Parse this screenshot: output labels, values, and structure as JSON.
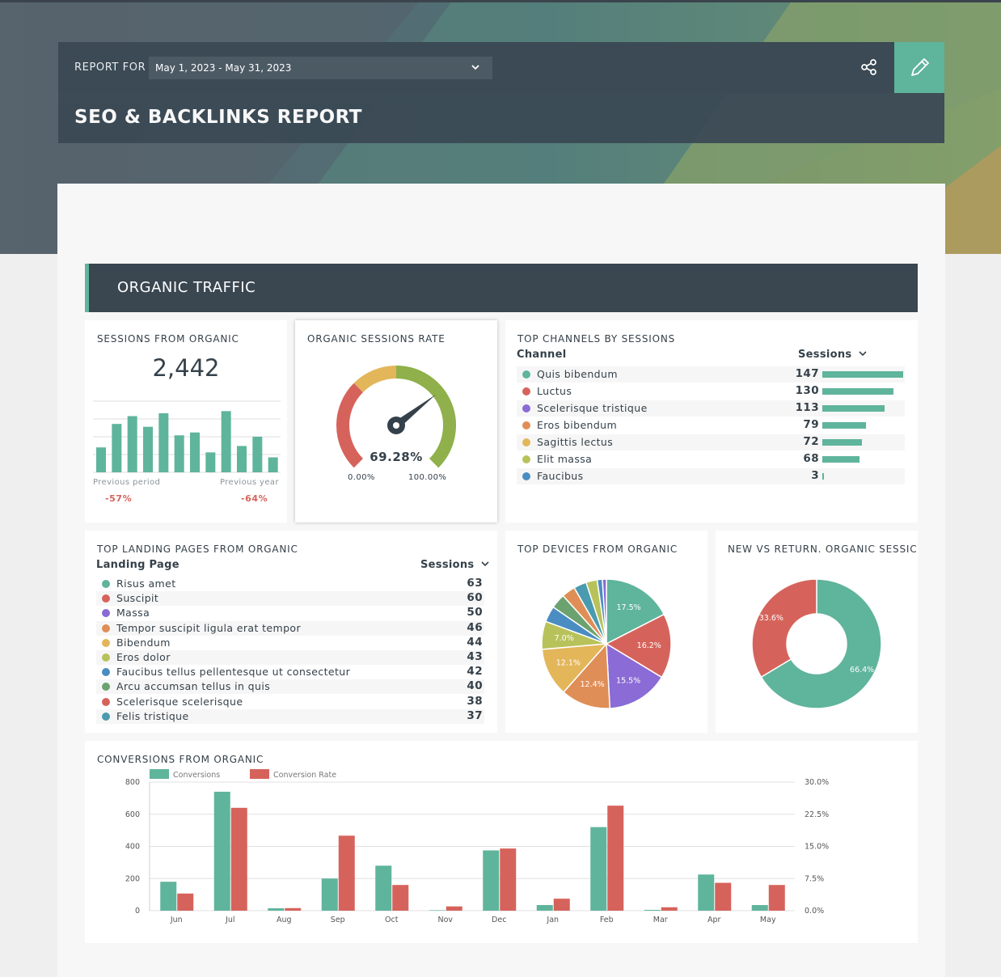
{
  "header": {
    "report_for_label": "REPORT FOR",
    "date_range": "May 1, 2023 - May 31, 2023",
    "title": "SEO & BACKLINKS REPORT"
  },
  "section": {
    "title": "ORGANIC TRAFFIC"
  },
  "colors": {
    "teal": "#5fb49c",
    "red": "#d6635b",
    "purple": "#8b6bd6",
    "orange": "#e08e57",
    "gold": "#e3b65a",
    "olive": "#b8c25a",
    "blue": "#4a8dc2",
    "green": "#6ca26f",
    "cyan": "#4a9ab0"
  },
  "sessions_organic": {
    "title": "SESSIONS FROM ORGANIC",
    "value": "2,442",
    "previous_period_label": "Previous period",
    "previous_period_change": "-57%",
    "previous_year_label": "Previous year",
    "previous_year_change": "-64%",
    "spark_values": [
      35,
      68,
      79,
      64,
      83,
      52,
      56,
      28,
      86,
      37,
      50,
      21
    ]
  },
  "sessions_rate": {
    "title": "ORGANIC SESSIONS RATE",
    "value": "69.28%",
    "value_number": 69.28,
    "min_label": "0.00%",
    "max_label": "100.00%"
  },
  "top_channels": {
    "title": "TOP CHANNELS BY SESSIONS",
    "col_channel": "Channel",
    "col_sessions": "Sessions",
    "rows": [
      {
        "name": "Quis bibendum",
        "value": "147",
        "n": 147,
        "color": "#5fb49c"
      },
      {
        "name": "Luctus",
        "value": "130",
        "n": 130,
        "color": "#d6635b"
      },
      {
        "name": "Scelerisque tristique",
        "value": "113",
        "n": 113,
        "color": "#8b6bd6"
      },
      {
        "name": "Eros bibendum",
        "value": "79",
        "n": 79,
        "color": "#e08e57"
      },
      {
        "name": "Sagittis lectus",
        "value": "72",
        "n": 72,
        "color": "#e3b65a"
      },
      {
        "name": "Elit massa",
        "value": "68",
        "n": 68,
        "color": "#b8c25a"
      },
      {
        "name": "Faucibus",
        "value": "3",
        "n": 3,
        "color": "#4a8dc2"
      }
    ]
  },
  "landing_pages": {
    "title": "TOP LANDING PAGES FROM ORGANIC",
    "col_page": "Landing Page",
    "col_sessions": "Sessions",
    "rows": [
      {
        "name": "Risus amet",
        "value": "63",
        "color": "#5fb49c"
      },
      {
        "name": "Suscipit",
        "value": "60",
        "color": "#d6635b"
      },
      {
        "name": "Massa",
        "value": "50",
        "color": "#8b6bd6"
      },
      {
        "name": "Tempor suscipit ligula erat tempor",
        "value": "46",
        "color": "#e08e57"
      },
      {
        "name": "Bibendum",
        "value": "44",
        "color": "#e3b65a"
      },
      {
        "name": "Eros dolor",
        "value": "43",
        "color": "#b8c25a"
      },
      {
        "name": "Faucibus tellus pellentesque ut consectetur",
        "value": "42",
        "color": "#4a8dc2"
      },
      {
        "name": "Arcu accumsan tellus in quis",
        "value": "40",
        "color": "#6ca26f"
      },
      {
        "name": "Scelerisque scelerisque",
        "value": "38",
        "color": "#d6635b"
      },
      {
        "name": "Felis tristique",
        "value": "37",
        "color": "#4a9ab0"
      }
    ]
  },
  "devices": {
    "title": "TOP DEVICES FROM ORGANIC",
    "slices": [
      {
        "pct": 17.5,
        "label": "17.5%",
        "color": "#5fb49c"
      },
      {
        "pct": 16.2,
        "label": "16.2%",
        "color": "#d6635b"
      },
      {
        "pct": 15.5,
        "label": "15.5%",
        "color": "#8b6bd6"
      },
      {
        "pct": 12.4,
        "label": "12.4%",
        "color": "#e08e57"
      },
      {
        "pct": 12.1,
        "label": "12.1%",
        "color": "#e3b65a"
      },
      {
        "pct": 7.0,
        "label": "7.0%",
        "color": "#b8c25a"
      },
      {
        "pct": 4.0,
        "label": "",
        "color": "#4a8dc2"
      },
      {
        "pct": 3.7,
        "label": "",
        "color": "#6ca26f"
      },
      {
        "pct": 3.4,
        "label": "",
        "color": "#e08e57"
      },
      {
        "pct": 3.2,
        "label": "",
        "color": "#4a9ab0"
      },
      {
        "pct": 2.8,
        "label": "",
        "color": "#b8c25a"
      },
      {
        "pct": 1.3,
        "label": "",
        "color": "#4a8dc2"
      },
      {
        "pct": 1.0,
        "label": "",
        "color": "#8b6bd6"
      }
    ]
  },
  "new_vs_return": {
    "title": "NEW VS RETURN. ORGANIC SESSIC",
    "slices": [
      {
        "pct": 66.4,
        "label": "66.4%",
        "color": "#5fb49c"
      },
      {
        "pct": 33.6,
        "label": "33.6%",
        "color": "#d6635b"
      }
    ]
  },
  "chart_data": {
    "type": "bar",
    "title": "CONVERSIONS FROM ORGANIC",
    "categories": [
      "Jun",
      "Jul",
      "Aug",
      "Sep",
      "Oct",
      "Nov",
      "Dec",
      "Jan",
      "Feb",
      "Mar",
      "Apr",
      "May"
    ],
    "series": [
      {
        "name": "Conversions",
        "axis": "left",
        "color": "#5fb49c",
        "values": [
          180,
          740,
          15,
          200,
          280,
          3,
          375,
          35,
          520,
          5,
          225,
          35
        ]
      },
      {
        "name": "Conversion Rate",
        "axis": "right",
        "color": "#d6635b",
        "values": [
          4.0,
          24.0,
          0.6,
          17.5,
          6.0,
          1.0,
          14.5,
          2.8,
          24.5,
          0.8,
          6.5,
          6.0
        ]
      }
    ],
    "ylim": [
      0,
      800
    ],
    "yticks": [
      "800",
      "600",
      "400",
      "200",
      "0"
    ],
    "y2lim": [
      0,
      30
    ],
    "y2ticks": [
      "30.0%",
      "22.5%",
      "15.0%",
      "7.5%",
      "0.0%"
    ],
    "legend": "top-left",
    "grid": true
  }
}
